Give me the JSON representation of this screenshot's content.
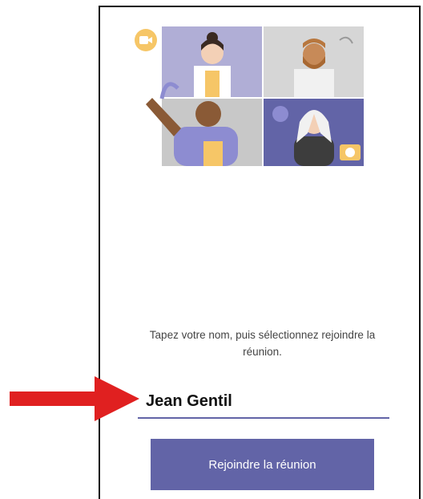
{
  "join": {
    "instructions": "Tapez votre nom, puis sélectionnez rejoindre la réunion.",
    "name_value": "Jean Gentil",
    "button_label": "Rejoindre la réunion"
  },
  "colors": {
    "accent": "#6264a7",
    "arrow": "#e02020"
  },
  "icons": [
    "video-camera-icon",
    "arrow-icon"
  ]
}
